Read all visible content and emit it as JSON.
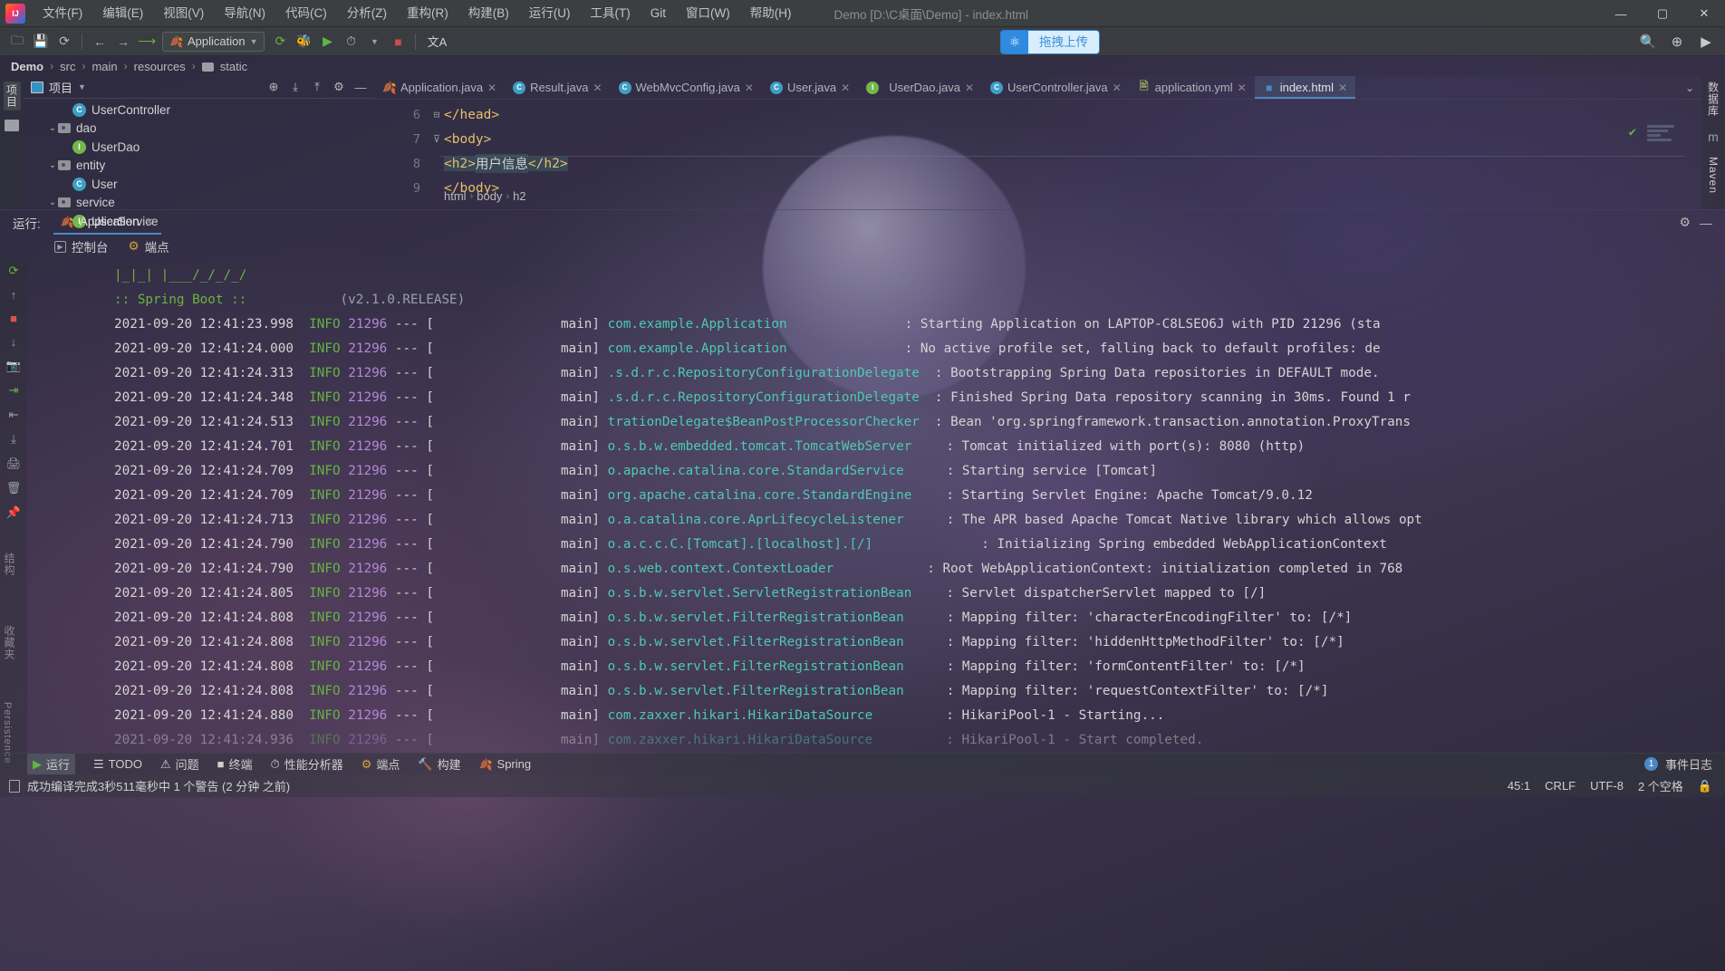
{
  "window": {
    "title": "Demo [D:\\C桌面\\Demo] - index.html",
    "minimize": "—",
    "maximize": "▢",
    "close": "✕"
  },
  "menu": {
    "items": [
      {
        "label": "文件(F)"
      },
      {
        "label": "编辑(E)"
      },
      {
        "label": "视图(V)"
      },
      {
        "label": "导航(N)"
      },
      {
        "label": "代码(C)"
      },
      {
        "label": "分析(Z)"
      },
      {
        "label": "重构(R)"
      },
      {
        "label": "构建(B)"
      },
      {
        "label": "运行(U)"
      },
      {
        "label": "工具(T)"
      },
      {
        "label": "Git"
      },
      {
        "label": "窗口(W)"
      },
      {
        "label": "帮助(H)"
      }
    ]
  },
  "toolbar": {
    "open_icon": "🗀",
    "save_icon": "💾",
    "sync_icon": "⟳",
    "back_icon": "←",
    "forward_icon": "→",
    "build_icon": "🔨",
    "run_config": "Application",
    "run_config_caret": "▼",
    "run_icon": "▶",
    "debug_icon": "🐞",
    "coverage_icon": "▶",
    "profile_icon": "⏱",
    "profile_caret": "▼",
    "stop_icon": "■",
    "translate_icon": "文A",
    "upload_label": "拖拽上传",
    "upload_icon": "⚛",
    "search_icon": "🔍",
    "plus_icon": "⊕",
    "play_icon": "▶"
  },
  "breadcrumb": {
    "project": "Demo",
    "separator": "›",
    "items": [
      "src",
      "main",
      "resources"
    ],
    "last": "static"
  },
  "left_strip": {
    "project_tab": "项目",
    "structure_icon": "folder-icon"
  },
  "right_strip": {
    "database_label": "数据库",
    "maven_label": "Maven",
    "maven_icon": "m"
  },
  "project_panel": {
    "title": "项目",
    "title_caret": "▼",
    "actions": [
      "⊕",
      "⤓",
      "⤒",
      "⚙",
      "—"
    ],
    "tree": [
      {
        "indent": 3,
        "type": "class",
        "badge": "C",
        "label": "UserController",
        "arrow": ""
      },
      {
        "indent": 2,
        "type": "folder",
        "label": "dao",
        "arrow": "⌄"
      },
      {
        "indent": 3,
        "type": "interface",
        "badge": "I",
        "label": "UserDao",
        "arrow": ""
      },
      {
        "indent": 2,
        "type": "folder",
        "label": "entity",
        "arrow": "⌄"
      },
      {
        "indent": 3,
        "type": "class",
        "badge": "C",
        "label": "User",
        "arrow": ""
      },
      {
        "indent": 2,
        "type": "folder",
        "label": "service",
        "arrow": "⌄"
      },
      {
        "indent": 3,
        "type": "interface",
        "badge": "I",
        "label": "UserService",
        "arrow": ""
      }
    ]
  },
  "editor": {
    "tabs": [
      {
        "label": "Application.java",
        "icon": "spring",
        "badge": "",
        "active": false,
        "close": "✕"
      },
      {
        "label": "Result.java",
        "icon": "class",
        "badge": "C",
        "active": false,
        "close": "✕"
      },
      {
        "label": "WebMvcConfig.java",
        "icon": "class",
        "badge": "C",
        "active": false,
        "close": "✕"
      },
      {
        "label": "User.java",
        "icon": "class",
        "badge": "C",
        "active": false,
        "close": "✕"
      },
      {
        "label": "UserDao.java",
        "icon": "interface",
        "badge": "I",
        "active": false,
        "close": "✕"
      },
      {
        "label": "UserController.java",
        "icon": "class",
        "badge": "C",
        "active": false,
        "close": "✕"
      },
      {
        "label": "application.yml",
        "icon": "yml",
        "badge": "",
        "active": false,
        "close": "✕"
      },
      {
        "label": "index.html",
        "icon": "html",
        "badge": "",
        "active": true,
        "close": "✕"
      }
    ],
    "tab_overflow": "⌄",
    "inspection_ok": "✔",
    "lines": [
      {
        "num": "6",
        "fold": "⊟",
        "text": "</head>",
        "selected": false
      },
      {
        "num": "7",
        "fold": "⊽",
        "text": "<body>",
        "selected": false
      },
      {
        "num": "8",
        "fold": "",
        "text": "<h2>用户信息</h2>",
        "selected": true,
        "tag_open": "<h2>",
        "content": "用户信息",
        "tag_close": "</h2>"
      },
      {
        "num": "9",
        "fold": "",
        "text": "</body>",
        "selected": false
      }
    ],
    "structure_path": [
      "html",
      "body",
      "h2"
    ],
    "structure_sep": "›"
  },
  "run_window": {
    "label": "运行:",
    "tab_label": "Application",
    "tab_close": "✕",
    "settings_icon": "⚙",
    "minimize_icon": "—",
    "subtabs": [
      {
        "label": "控制台",
        "icon": "console-icon"
      },
      {
        "label": "端点",
        "icon": "endpoints-icon"
      }
    ],
    "gutter_icons": [
      "⟳",
      "↑",
      "■",
      "↓",
      "📷",
      "⇥",
      "⇤",
      "⤓",
      "🖨",
      "🗑",
      "📌"
    ],
    "banner_art": "|_|_| |___/_/_/_/",
    "banner_text": ":: Spring Boot ::",
    "banner_version": "(v2.1.0.RELEASE)",
    "log_lines": [
      {
        "ts": "2021-09-20 12:41:23.998",
        "lvl": "INFO",
        "pid": "21296",
        "thread": "main]",
        "logger": "com.example.Application",
        "msg": "Starting Application on LAPTOP-C8LSEO6J with PID 21296 (sta"
      },
      {
        "ts": "2021-09-20 12:41:24.000",
        "lvl": "INFO",
        "pid": "21296",
        "thread": "main]",
        "logger": "com.example.Application",
        "msg": "No active profile set, falling back to default profiles: de"
      },
      {
        "ts": "2021-09-20 12:41:24.313",
        "lvl": "INFO",
        "pid": "21296",
        "thread": "main]",
        "logger": ".s.d.r.c.RepositoryConfigurationDelegate",
        "msg": "Bootstrapping Spring Data repositories in DEFAULT mode."
      },
      {
        "ts": "2021-09-20 12:41:24.348",
        "lvl": "INFO",
        "pid": "21296",
        "thread": "main]",
        "logger": ".s.d.r.c.RepositoryConfigurationDelegate",
        "msg": "Finished Spring Data repository scanning in 30ms. Found 1 r"
      },
      {
        "ts": "2021-09-20 12:41:24.513",
        "lvl": "INFO",
        "pid": "21296",
        "thread": "main]",
        "logger": "trationDelegate$BeanPostProcessorChecker",
        "msg": "Bean 'org.springframework.transaction.annotation.ProxyTrans"
      },
      {
        "ts": "2021-09-20 12:41:24.701",
        "lvl": "INFO",
        "pid": "21296",
        "thread": "main]",
        "logger": "o.s.b.w.embedded.tomcat.TomcatWebServer",
        "msg": "Tomcat initialized with port(s): 8080 (http)"
      },
      {
        "ts": "2021-09-20 12:41:24.709",
        "lvl": "INFO",
        "pid": "21296",
        "thread": "main]",
        "logger": "o.apache.catalina.core.StandardService",
        "msg": "Starting service [Tomcat]"
      },
      {
        "ts": "2021-09-20 12:41:24.709",
        "lvl": "INFO",
        "pid": "21296",
        "thread": "main]",
        "logger": "org.apache.catalina.core.StandardEngine",
        "msg": "Starting Servlet Engine: Apache Tomcat/9.0.12"
      },
      {
        "ts": "2021-09-20 12:41:24.713",
        "lvl": "INFO",
        "pid": "21296",
        "thread": "main]",
        "logger": "o.a.catalina.core.AprLifecycleListener",
        "msg": "The APR based Apache Tomcat Native library which allows opt"
      },
      {
        "ts": "2021-09-20 12:41:24.790",
        "lvl": "INFO",
        "pid": "21296",
        "thread": "main]",
        "logger": "o.a.c.c.C.[Tomcat].[localhost].[/]",
        "msg": "Initializing Spring embedded WebApplicationContext"
      },
      {
        "ts": "2021-09-20 12:41:24.790",
        "lvl": "INFO",
        "pid": "21296",
        "thread": "main]",
        "logger": "o.s.web.context.ContextLoader",
        "msg": "Root WebApplicationContext: initialization completed in 768"
      },
      {
        "ts": "2021-09-20 12:41:24.805",
        "lvl": "INFO",
        "pid": "21296",
        "thread": "main]",
        "logger": "o.s.b.w.servlet.ServletRegistrationBean",
        "msg": "Servlet dispatcherServlet mapped to [/]"
      },
      {
        "ts": "2021-09-20 12:41:24.808",
        "lvl": "INFO",
        "pid": "21296",
        "thread": "main]",
        "logger": "o.s.b.w.servlet.FilterRegistrationBean",
        "msg": "Mapping filter: 'characterEncodingFilter' to: [/*]"
      },
      {
        "ts": "2021-09-20 12:41:24.808",
        "lvl": "INFO",
        "pid": "21296",
        "thread": "main]",
        "logger": "o.s.b.w.servlet.FilterRegistrationBean",
        "msg": "Mapping filter: 'hiddenHttpMethodFilter' to: [/*]"
      },
      {
        "ts": "2021-09-20 12:41:24.808",
        "lvl": "INFO",
        "pid": "21296",
        "thread": "main]",
        "logger": "o.s.b.w.servlet.FilterRegistrationBean",
        "msg": "Mapping filter: 'formContentFilter' to: [/*]"
      },
      {
        "ts": "2021-09-20 12:41:24.808",
        "lvl": "INFO",
        "pid": "21296",
        "thread": "main]",
        "logger": "o.s.b.w.servlet.FilterRegistrationBean",
        "msg": "Mapping filter: 'requestContextFilter' to: [/*]"
      },
      {
        "ts": "2021-09-20 12:41:24.880",
        "lvl": "INFO",
        "pid": "21296",
        "thread": "main]",
        "logger": "com.zaxxer.hikari.HikariDataSource",
        "msg": "HikariPool-1 - Starting..."
      },
      {
        "ts": "2021-09-20 12:41:24.936",
        "lvl": "INFO",
        "pid": "21296",
        "thread": "main]",
        "logger": "com.zaxxer.hikari.HikariDataSource",
        "msg": "HikariPool-1 - Start completed."
      }
    ]
  },
  "bottom_bar": {
    "items": [
      {
        "label": "运行",
        "icon": "play-icon",
        "active": true
      },
      {
        "label": "TODO",
        "icon": "todo-icon",
        "active": false
      },
      {
        "label": "问题",
        "icon": "problems-icon",
        "active": false
      },
      {
        "label": "终端",
        "icon": "terminal-icon",
        "active": false
      },
      {
        "label": "性能分析器",
        "icon": "profiler-icon",
        "active": false
      },
      {
        "label": "端点",
        "icon": "endpoints-icon",
        "active": false
      },
      {
        "label": "构建",
        "icon": "build-icon",
        "active": false
      },
      {
        "label": "Spring",
        "icon": "spring-icon",
        "active": false
      }
    ],
    "event_count": "1",
    "event_label": "事件日志"
  },
  "status_bar": {
    "message": "成功编译完成3秒511毫秒中 1 个警告 (2 分钟 之前)",
    "caret_position": "45:1",
    "line_separator": "CRLF",
    "encoding": "UTF-8",
    "indent": "2 个空格",
    "lock_icon": "🔒"
  },
  "left_vertical_tabs": {
    "structure": "结构",
    "favorites": "收藏夹",
    "persistence": "Persistence"
  }
}
